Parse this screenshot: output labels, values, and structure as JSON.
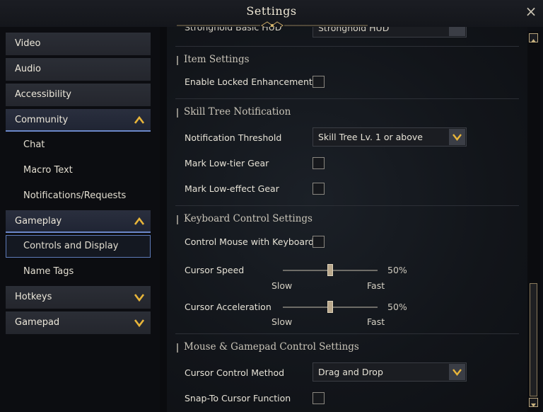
{
  "window": {
    "title": "Settings",
    "close_icon": "×"
  },
  "nav": {
    "items": [
      {
        "label": "Video"
      },
      {
        "label": "Audio"
      },
      {
        "label": "Accessibility"
      },
      {
        "label": "Community"
      },
      {
        "label": "Chat"
      },
      {
        "label": "Macro Text"
      },
      {
        "label": "Notifications/Requests"
      },
      {
        "label": "Gameplay"
      },
      {
        "label": "Controls and Display"
      },
      {
        "label": "Name Tags"
      },
      {
        "label": "Hotkeys"
      },
      {
        "label": "Gamepad"
      }
    ],
    "selected": "Controls and Display"
  },
  "main": {
    "cut_row": {
      "label": "Stronghold Basic HUD",
      "value": "Stronghold HUD"
    },
    "item_settings": {
      "title": "Item Settings",
      "enable_locked_enhancements": {
        "label": "Enable Locked Enhancements",
        "checked": false
      }
    },
    "skill_tree": {
      "title": "Skill Tree Notification",
      "notification_threshold": {
        "label": "Notification Threshold",
        "value": "Skill Tree Lv. 1 or above"
      },
      "mark_low_tier_gear": {
        "label": "Mark Low-tier Gear",
        "checked": false
      },
      "mark_low_effect_gear": {
        "label": "Mark Low-effect Gear",
        "checked": false
      }
    },
    "keyboard": {
      "title": "Keyboard Control Settings",
      "control_mouse": {
        "label": "Control Mouse with Keyboard",
        "checked": false
      },
      "cursor_speed": {
        "label": "Cursor Speed",
        "value_text": "50%",
        "value": 0.5,
        "min_label": "Slow",
        "max_label": "Fast"
      },
      "cursor_acceleration": {
        "label": "Cursor Acceleration",
        "value_text": "50%",
        "value": 0.5,
        "min_label": "Slow",
        "max_label": "Fast"
      }
    },
    "mouse_gamepad": {
      "title": "Mouse & Gamepad Control Settings",
      "cursor_control_method": {
        "label": "Cursor Control Method",
        "value": "Drag and Drop"
      },
      "snap_to_cursor": {
        "label": "Snap-To Cursor Function",
        "checked": false
      }
    }
  },
  "colors": {
    "accent_gold": "#e8b53a",
    "selected_outline": "#5e7bb9"
  }
}
